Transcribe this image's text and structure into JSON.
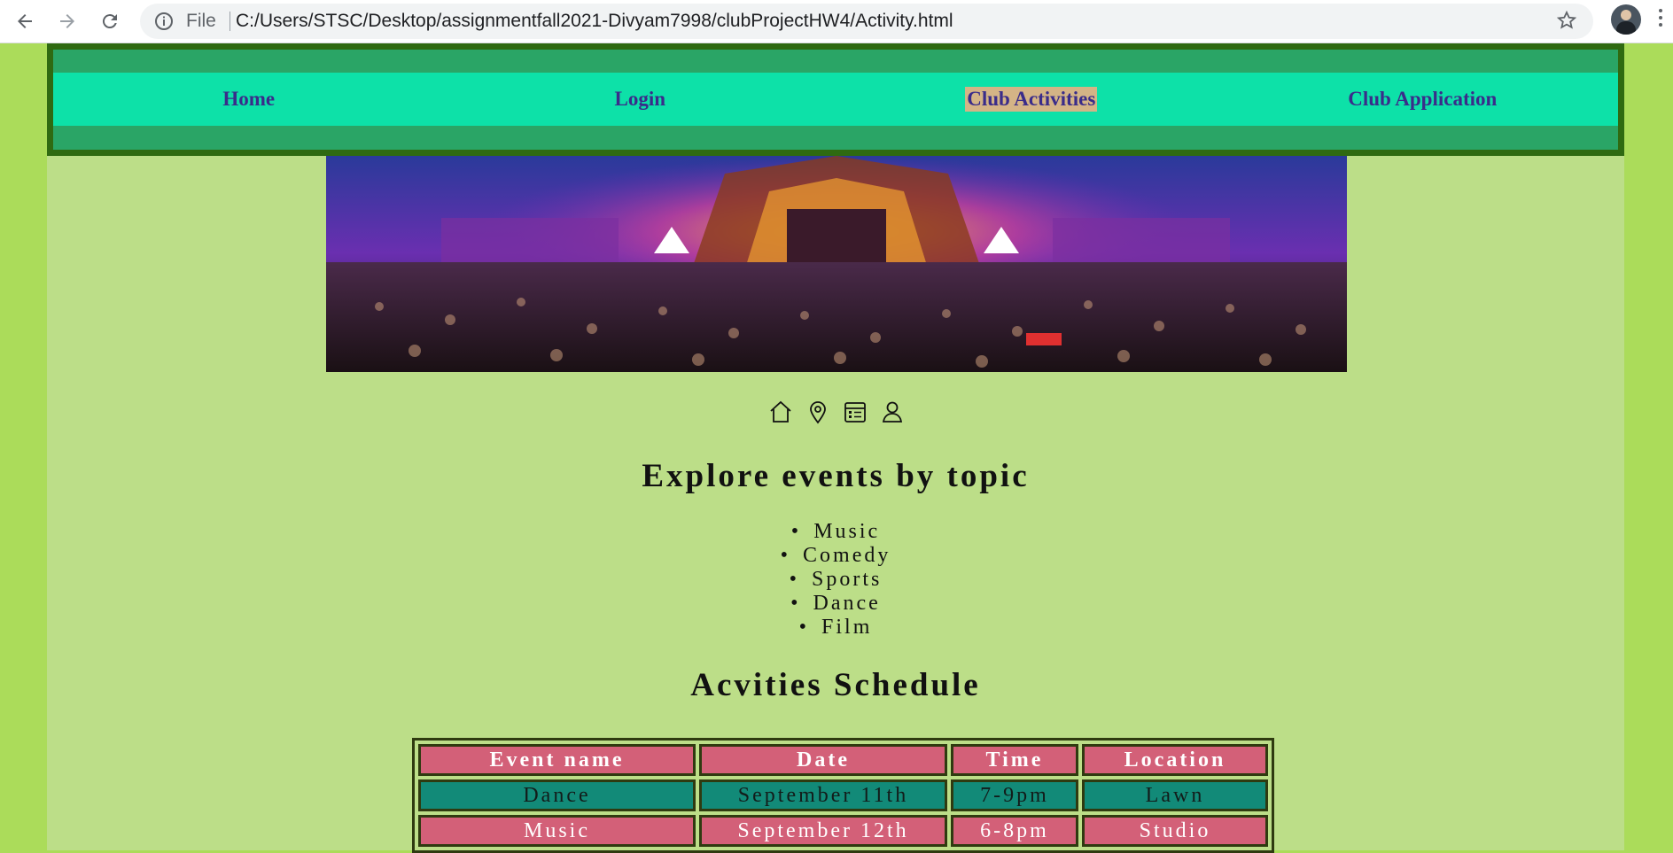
{
  "browser": {
    "file_label": "File",
    "url": "C:/Users/STSC/Desktop/assignmentfall2021-Divyam7998/clubProjectHW4/Activity.html"
  },
  "nav": {
    "items": [
      {
        "label": "Home"
      },
      {
        "label": "Login"
      },
      {
        "label": "Club Activities"
      },
      {
        "label": "Club Application"
      }
    ]
  },
  "icons": [
    "home-icon",
    "location-pin-icon",
    "calendar-icon",
    "user-icon"
  ],
  "topics": {
    "heading": "Explore events by topic",
    "items": [
      "Music",
      "Comedy",
      "Sports",
      "Dance",
      "Film"
    ]
  },
  "schedule": {
    "heading": "Acvities Schedule",
    "columns": [
      "Event name",
      "Date",
      "Time",
      "Location"
    ],
    "rows": [
      [
        "Dance",
        "September 11th",
        "7-9pm",
        "Lawn"
      ],
      [
        "Music",
        "September 12th",
        "6-8pm",
        "Studio"
      ]
    ]
  },
  "colors": {
    "page_bg": "#abdc5a",
    "content_bg": "#bcde88",
    "header_bg": "#2aa566",
    "menu_bg": "#0de1a8",
    "active_highlight": "#d4b486",
    "table_pink": "#d36078",
    "table_teal": "#128a78"
  }
}
